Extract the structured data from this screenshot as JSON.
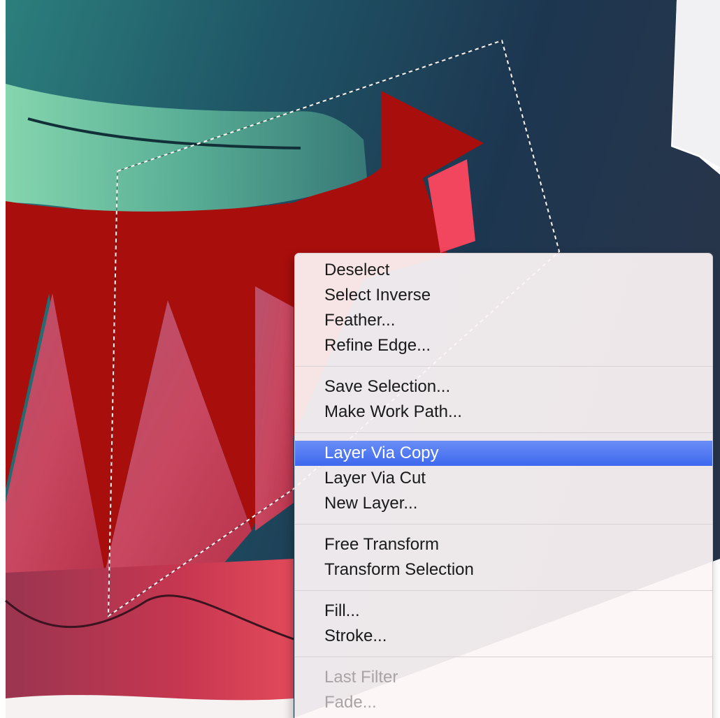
{
  "context_menu": {
    "groups": [
      {
        "items": [
          {
            "label": "Deselect",
            "state": "normal"
          },
          {
            "label": "Select Inverse",
            "state": "normal"
          },
          {
            "label": "Feather...",
            "state": "normal"
          },
          {
            "label": "Refine Edge...",
            "state": "normal"
          }
        ]
      },
      {
        "items": [
          {
            "label": "Save Selection...",
            "state": "normal"
          },
          {
            "label": "Make Work Path...",
            "state": "normal"
          }
        ]
      },
      {
        "items": [
          {
            "label": "Layer Via Copy",
            "state": "highlighted"
          },
          {
            "label": "Layer Via Cut",
            "state": "normal"
          },
          {
            "label": "New Layer...",
            "state": "normal"
          }
        ]
      },
      {
        "items": [
          {
            "label": "Free Transform",
            "state": "normal"
          },
          {
            "label": "Transform Selection",
            "state": "normal"
          }
        ]
      },
      {
        "items": [
          {
            "label": "Fill...",
            "state": "normal"
          },
          {
            "label": "Stroke...",
            "state": "normal"
          }
        ]
      },
      {
        "items": [
          {
            "label": "Last Filter",
            "state": "disabled"
          },
          {
            "label": "Fade...",
            "state": "disabled"
          }
        ]
      }
    ]
  },
  "colors": {
    "highlight": "#4a74f0",
    "red_shape": "#a80e0c",
    "pink_shape": "#f2455e",
    "space_dark": "#1e3448",
    "space_teal": "#2a7a7a"
  }
}
